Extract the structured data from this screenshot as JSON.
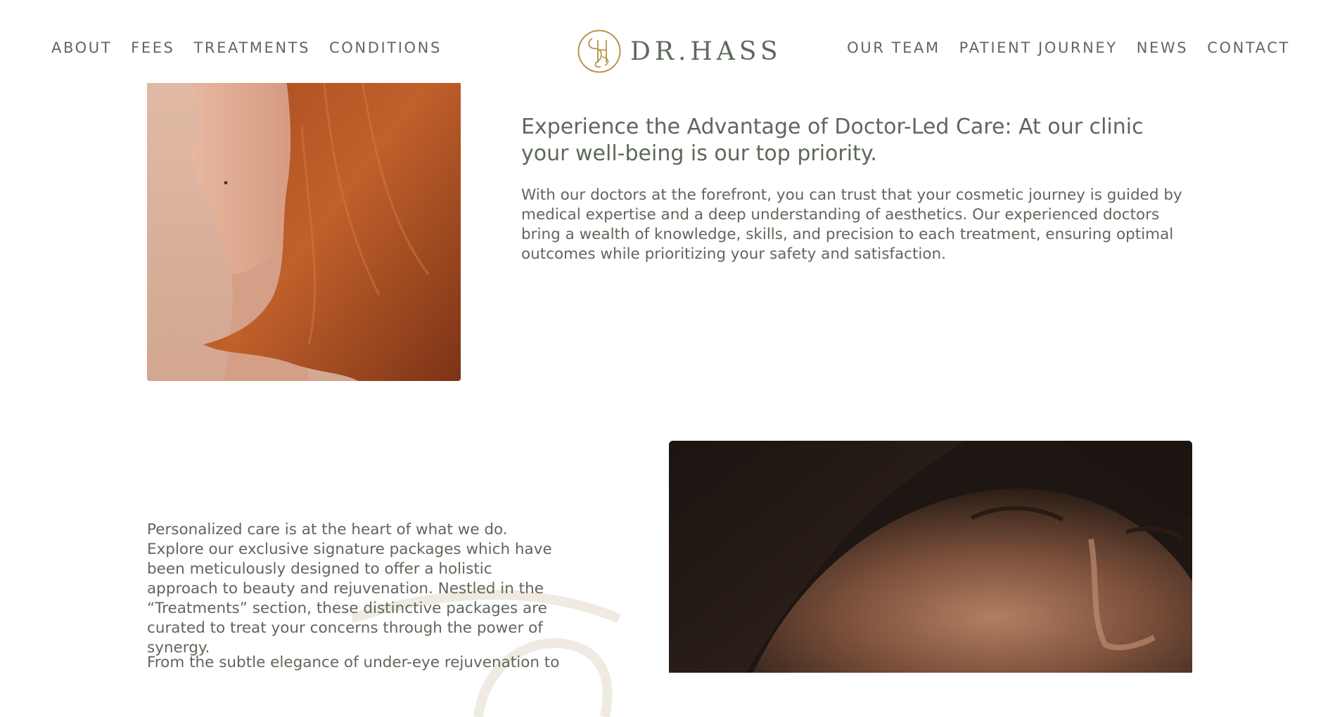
{
  "nav_left": [
    "ABOUT",
    "FEES",
    "TREATMENTS",
    "CONDITIONS"
  ],
  "nav_right": [
    "OUR TEAM",
    "PATIENT JOURNEY",
    "NEWS",
    "CONTACT"
  ],
  "logo": {
    "wordmark": "DR.HASS"
  },
  "section1": {
    "headline": "Experience the Advantage of Doctor-Led Care: At our clinic your well-being is our top priority.",
    "body": "With our doctors at the forefront, you can trust that your cosmetic journey is guided by medical expertise and a deep understanding of aesthetics. Our experienced doctors bring a wealth of knowledge, skills, and precision to each treatment, ensuring optimal outcomes while prioritizing your safety and satisfaction."
  },
  "section2": {
    "body": "Personalized care is at the heart of what we do. Explore our exclusive signature packages which have been meticulously designed to offer a holistic approach to beauty and rejuvenation. Nestled in the “Treatments” section, these distinctive packages are curated to treat your concerns through the power of synergy.",
    "body_cut": "From the subtle elegance of under-eye rejuvenation to"
  },
  "colors": {
    "text": "#5d685a",
    "gold": "#b8944a",
    "swirl": "#efebe2"
  }
}
